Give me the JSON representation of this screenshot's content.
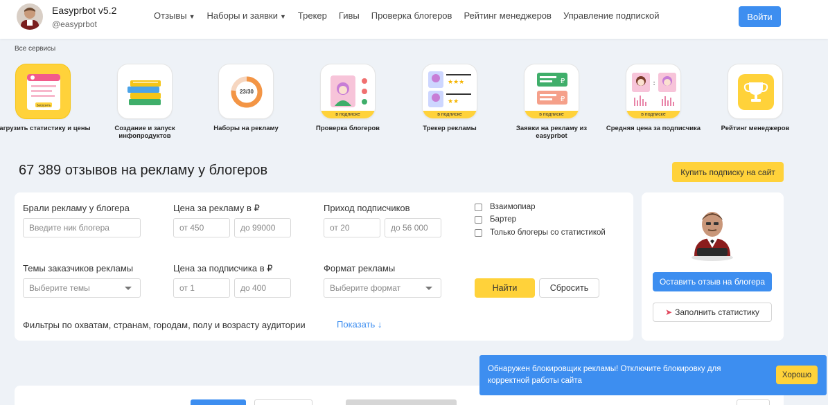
{
  "header": {
    "title": "Easyprbot v5.2",
    "handle": "@easyprbot",
    "nav": [
      {
        "label": "Отзывы",
        "dropdown": true
      },
      {
        "label": "Наборы и заявки",
        "dropdown": true
      },
      {
        "label": "Трекер",
        "dropdown": false
      },
      {
        "label": "Гивы",
        "dropdown": false
      },
      {
        "label": "Проверка блогеров",
        "dropdown": false
      },
      {
        "label": "Рейтинг менеджеров",
        "dropdown": false
      },
      {
        "label": "Управление подпиской",
        "dropdown": false
      }
    ],
    "login_label": "Войти"
  },
  "services": {
    "heading": "Все сервисы",
    "items": [
      {
        "label": "Загрузить статистику и цены",
        "icon": "upload-stats-icon",
        "tile_text": "Загрузить",
        "tag": ""
      },
      {
        "label": "Создание и запуск инфопродуктов",
        "icon": "books-icon",
        "tag": ""
      },
      {
        "label": "Наборы на рекламу",
        "icon": "progress-ring-icon",
        "tile_text": "23/30",
        "progress": 0.767,
        "tag": ""
      },
      {
        "label": "Проверка блогеров",
        "icon": "blogger-check-icon",
        "tag": "в подписке"
      },
      {
        "label": "Трекер рекламы",
        "icon": "rating-tracker-icon",
        "tag": "в подписке"
      },
      {
        "label": "Заявки на рекламу из easyprbot",
        "icon": "ad-requests-icon",
        "tag": "в подписке"
      },
      {
        "label": "Средняя цена за подписчика",
        "icon": "price-compare-icon",
        "tag": "в подписке"
      },
      {
        "label": "Рейтинг менеджеров",
        "icon": "trophy-icon",
        "tag": ""
      }
    ]
  },
  "main": {
    "title": "67 389 отзывов на рекламу у блогеров",
    "buy_label": "Купить подписку на сайт"
  },
  "filters": {
    "blogger_label": "Брали рекламу у блогера",
    "blogger_placeholder": "Введите ник блогера",
    "price_label": "Цена за рекламу в ₽",
    "price_from": "от 450",
    "price_to": "до 99000",
    "income_label": "Приход подписчиков",
    "income_from": "от 20",
    "income_to": "до 56 000",
    "topics_label": "Темы заказчиков рекламы",
    "topics_placeholder": "Выберите темы",
    "sub_price_label": "Цена за подписчика в ₽",
    "sub_price_from": "от 1",
    "sub_price_to": "до 400",
    "format_label": "Формат рекламы",
    "format_placeholder": "Выберите формат",
    "checkboxes": [
      {
        "label": "Взаимопиар",
        "checked": false
      },
      {
        "label": "Бартер",
        "checked": false
      },
      {
        "label": "Только блогеры со статистикой",
        "checked": false
      }
    ],
    "find_label": "Найти",
    "reset_label": "Сбросить",
    "audience_label": "Фильтры по охватам, странам, городам, полу и возрасту аудитории",
    "show_label": "Показать ↓"
  },
  "side": {
    "review_label": "Оставить отзыв на блогера",
    "stats_label": "Заполнить статистику"
  },
  "notice": {
    "text": "Обнаружен блокировщик рекламы! Отключите блокировку для корректной работы сайта",
    "ok_label": "Хорошо"
  },
  "colors": {
    "accent_blue": "#3d8ef0",
    "accent_yellow": "#ffd23a",
    "background": "#eef2f7"
  }
}
